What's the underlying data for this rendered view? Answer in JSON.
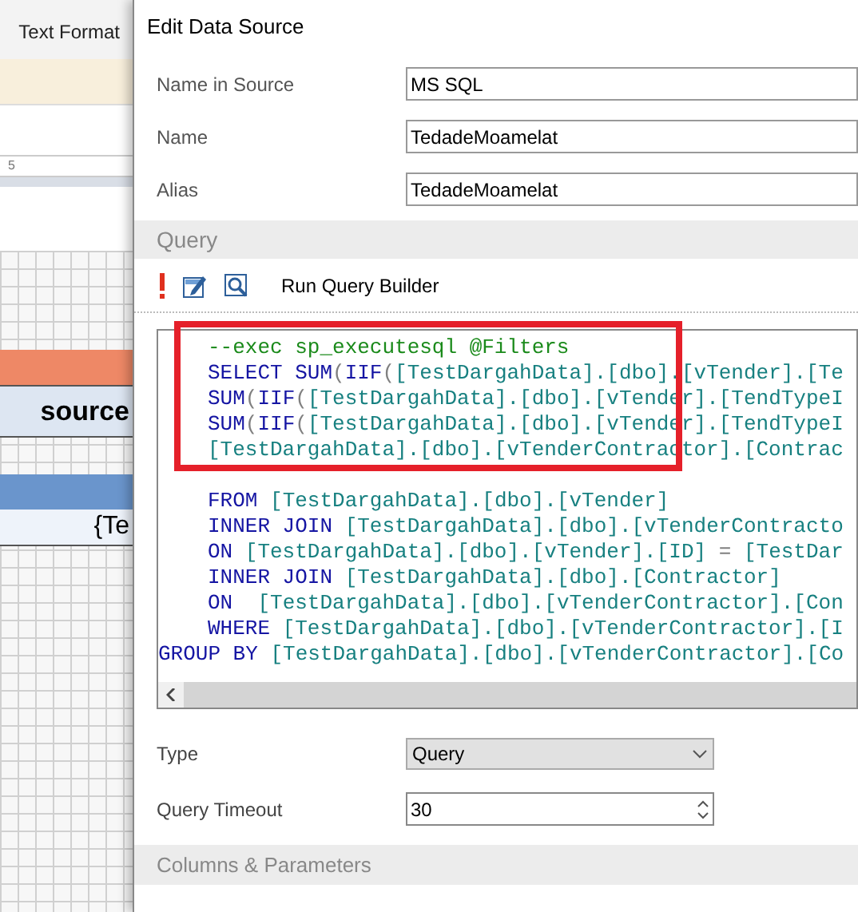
{
  "background": {
    "toolbar_label": "Text Format",
    "ruler_mark": "5",
    "header_cell": "source",
    "data_cell": "{Te"
  },
  "dialog": {
    "title": "Edit Data Source",
    "fields": [
      {
        "label": "Name in Source",
        "value": "MS SQL"
      },
      {
        "label": "Name",
        "value": "TedadeMoamelat"
      },
      {
        "label": "Alias",
        "value": "TedadeMoamelat"
      }
    ],
    "query_section": "Query",
    "toolbar": {
      "run_label": "Run Query Builder"
    },
    "code_lines": [
      {
        "indented": true,
        "segments": [
          {
            "kind": "comment",
            "text": "--exec sp_executesql @Filters"
          }
        ]
      },
      {
        "indented": true,
        "segments": [
          {
            "kind": "keyword",
            "text": "SELECT SUM"
          },
          {
            "kind": "punct",
            "text": "("
          },
          {
            "kind": "keyword",
            "text": "IIF"
          },
          {
            "kind": "punct",
            "text": "("
          },
          {
            "kind": "ident",
            "text": "[TestDargahData].[dbo].[vTender].[Te"
          }
        ]
      },
      {
        "indented": true,
        "segments": [
          {
            "kind": "keyword",
            "text": "SUM"
          },
          {
            "kind": "punct",
            "text": "("
          },
          {
            "kind": "keyword",
            "text": "IIF"
          },
          {
            "kind": "punct",
            "text": "("
          },
          {
            "kind": "ident",
            "text": "[TestDargahData].[dbo].[vTender].[TendTypeI"
          }
        ]
      },
      {
        "indented": true,
        "segments": [
          {
            "kind": "keyword",
            "text": "SUM"
          },
          {
            "kind": "punct",
            "text": "("
          },
          {
            "kind": "keyword",
            "text": "IIF"
          },
          {
            "kind": "punct",
            "text": "("
          },
          {
            "kind": "ident",
            "text": "[TestDargahData].[dbo].[vTender].[TendTypeI"
          }
        ]
      },
      {
        "indented": true,
        "segments": [
          {
            "kind": "ident",
            "text": "[TestDargahData].[dbo].[vTenderContractor].[Contrac"
          }
        ]
      },
      {
        "indented": true,
        "blank_before": true,
        "segments": [
          {
            "kind": "keyword",
            "text": "FROM "
          },
          {
            "kind": "ident",
            "text": "[TestDargahData].[dbo].[vTender]"
          }
        ]
      },
      {
        "indented": true,
        "segments": [
          {
            "kind": "keyword",
            "text": "INNER JOIN "
          },
          {
            "kind": "ident",
            "text": "[TestDargahData].[dbo].[vTenderContracto"
          }
        ]
      },
      {
        "indented": true,
        "segments": [
          {
            "kind": "keyword",
            "text": "ON "
          },
          {
            "kind": "ident",
            "text": "[TestDargahData].[dbo].[vTender].[ID] "
          },
          {
            "kind": "punct",
            "text": "="
          },
          {
            "kind": "ident",
            "text": " [TestDar"
          }
        ]
      },
      {
        "indented": true,
        "segments": [
          {
            "kind": "keyword",
            "text": "INNER JOIN "
          },
          {
            "kind": "ident",
            "text": "[TestDargahData].[dbo].[Contractor]"
          }
        ]
      },
      {
        "indented": true,
        "segments": [
          {
            "kind": "keyword",
            "text": "ON  "
          },
          {
            "kind": "ident",
            "text": "[TestDargahData].[dbo].[vTenderContractor].[Con"
          }
        ]
      },
      {
        "indented": true,
        "segments": [
          {
            "kind": "keyword",
            "text": "WHERE "
          },
          {
            "kind": "ident",
            "text": "[TestDargahData].[dbo].[vTenderContractor].[I"
          }
        ]
      },
      {
        "indented": false,
        "segments": [
          {
            "kind": "keyword",
            "text": "GROUP BY "
          },
          {
            "kind": "ident",
            "text": "[TestDargahData].[dbo].[vTenderContractor].[Co"
          }
        ]
      }
    ],
    "type": {
      "label": "Type",
      "value": "Query"
    },
    "timeout": {
      "label": "Query Timeout",
      "value": "30"
    },
    "columns_section": "Columns & Parameters"
  }
}
